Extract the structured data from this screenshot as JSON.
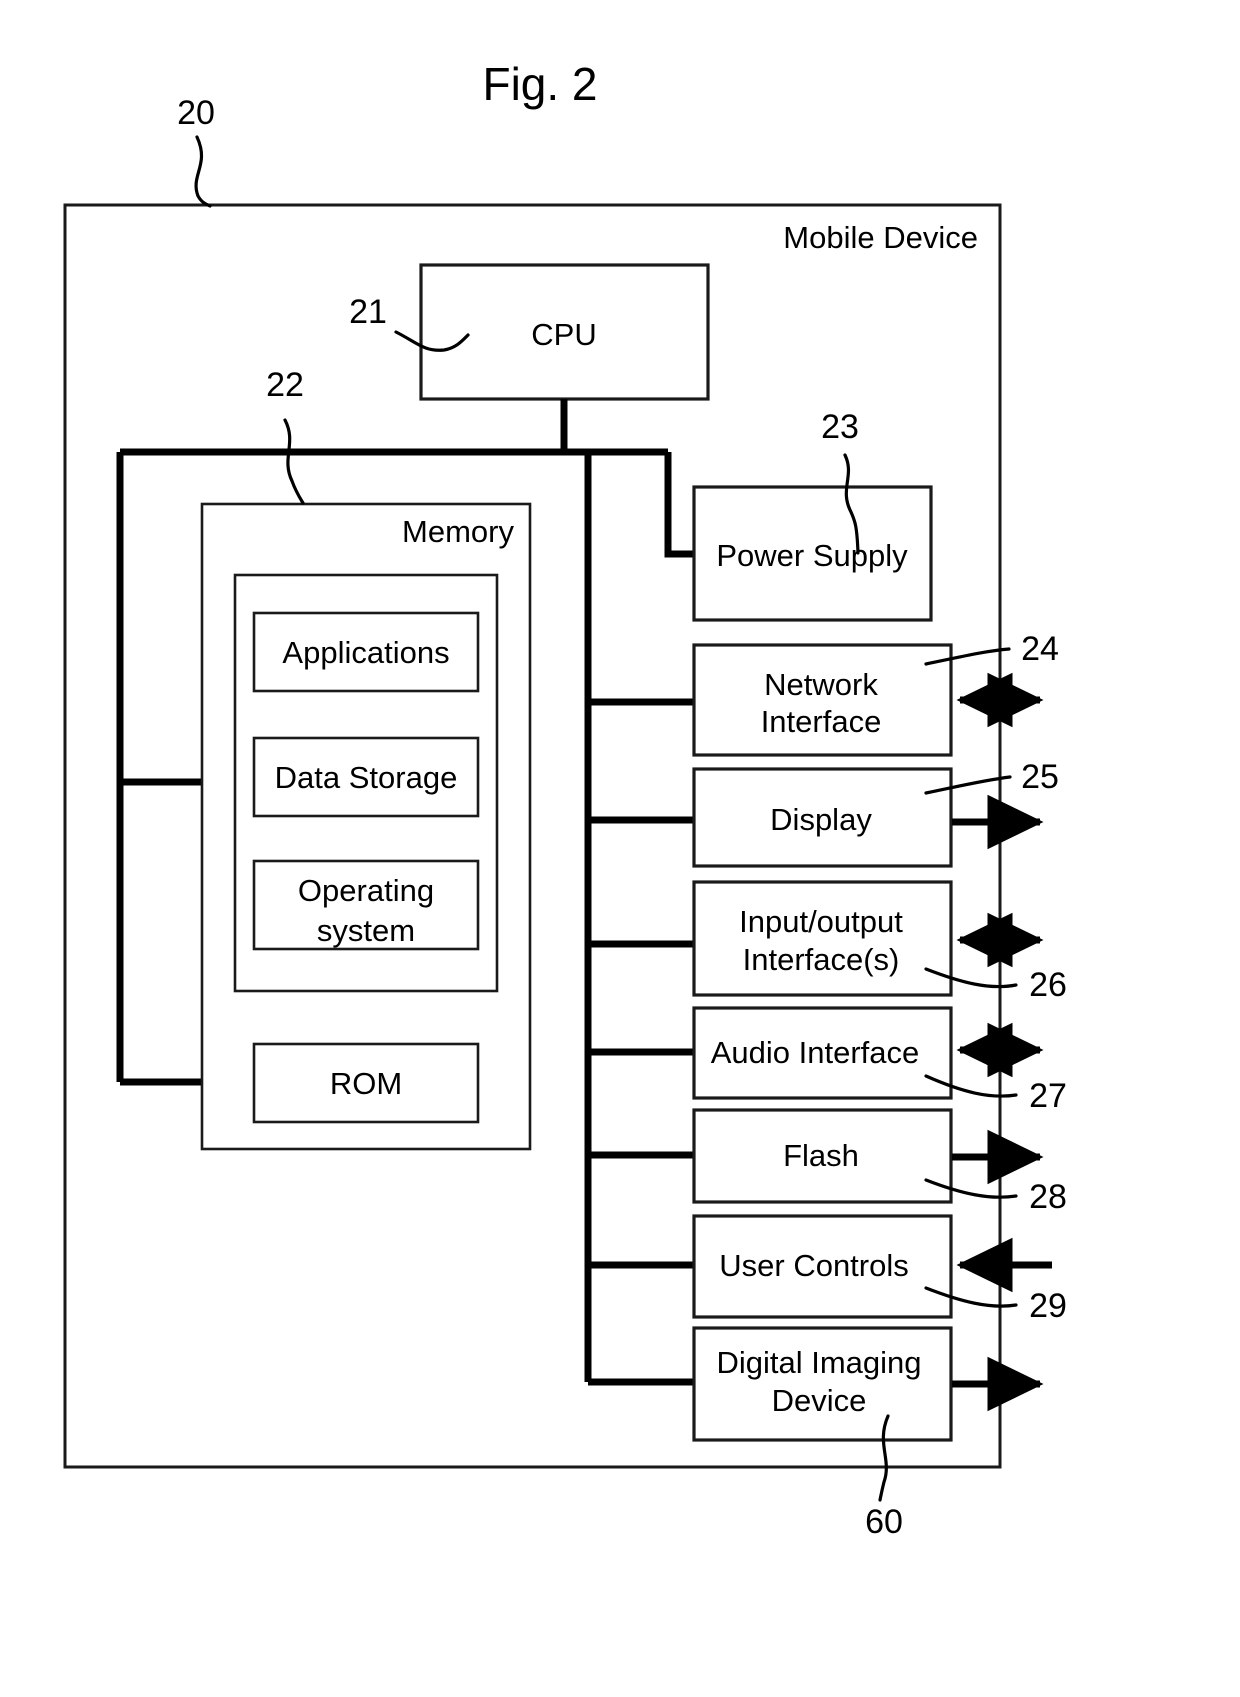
{
  "figure": {
    "title": "Fig. 2",
    "outer_label": "Mobile Device",
    "outer_ref": "20"
  },
  "blocks": {
    "cpu": {
      "label": "CPU",
      "ref": "21"
    },
    "memory": {
      "label": "Memory",
      "ref": "22"
    },
    "applications": {
      "label": "Applications"
    },
    "data_storage": {
      "label": "Data Storage"
    },
    "operating_system_line1": "Operating",
    "operating_system_line2": "system",
    "rom": {
      "label": "ROM"
    },
    "power_supply": {
      "label": "Power Supply",
      "ref": "23"
    },
    "network_interface_line1": "Network",
    "network_interface_line2": "Interface",
    "network_interface_ref": "24",
    "display": {
      "label": "Display",
      "ref": "25"
    },
    "io_interface_line1": "Input/output",
    "io_interface_line2": "Interface(s)",
    "io_interface_ref": "26",
    "audio_interface": {
      "label": "Audio Interface",
      "ref": "27"
    },
    "flash": {
      "label": "Flash",
      "ref": "28"
    },
    "user_controls": {
      "label": "User Controls",
      "ref": "29"
    },
    "digital_imaging_line1": "Digital Imaging",
    "digital_imaging_line2": "Device",
    "digital_imaging_ref": "60"
  },
  "colors": {
    "ink": "#000000",
    "paper": "#ffffff"
  }
}
